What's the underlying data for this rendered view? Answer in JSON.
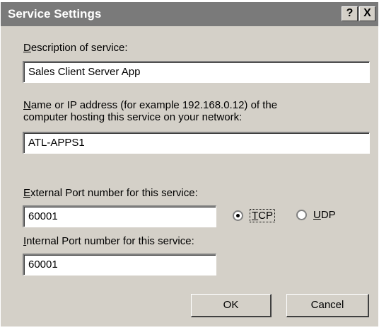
{
  "window": {
    "title": "Service Settings",
    "help_glyph": "?",
    "close_glyph": "X"
  },
  "description": {
    "label_accel": "D",
    "label_rest": "escription of service:",
    "value": "Sales Client Server App"
  },
  "host": {
    "label_accel": "N",
    "label_line1_rest": "ame or IP address (for example 192.168.0.12) of the",
    "label_line2": "computer hosting this service on your network:",
    "value": "ATL-APPS1"
  },
  "external_port": {
    "label_accel": "E",
    "label_rest": "xternal Port number for this service:",
    "value": "60001"
  },
  "internal_port": {
    "label_accel": "I",
    "label_rest": "nternal Port number for this service:",
    "value": "60001"
  },
  "protocol": {
    "tcp_accel": "T",
    "tcp_rest": "CP",
    "udp_accel": "U",
    "udp_rest": "DP",
    "selected": "TCP"
  },
  "buttons": {
    "ok": "OK",
    "cancel": "Cancel"
  }
}
